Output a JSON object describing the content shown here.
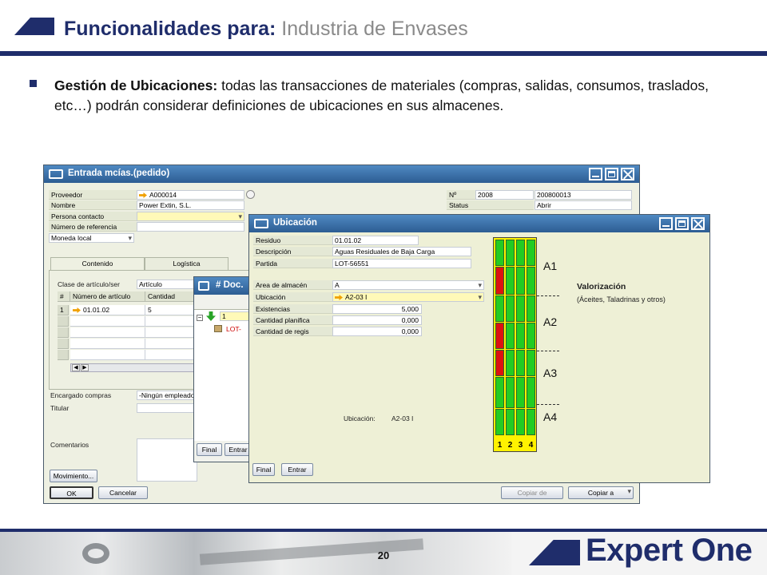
{
  "slide": {
    "title_bold": "Funcionalidades para:",
    "title_rest": " Industria de Envases",
    "bullet_bold": "Gestión de Ubicaciones:",
    "bullet_text": " todas las transacciones de materiales (compras, salidas, consumos, traslados, etc…) podrán considerar definiciones de ubicaciones en sus almacenes.",
    "page_number": "20",
    "logo": "Expert One"
  },
  "win_entrada": {
    "title": "Entrada mcías.(pedido)",
    "labels": [
      "Proveedor",
      "Nombre",
      "Persona contacto",
      "Número de referencia"
    ],
    "proveedor": "A000014",
    "nombre": "Power Extin, S.L.",
    "moneda": "Moneda local",
    "no_label": "Nº",
    "no_value_1": "2008",
    "no_value_2": "200800013",
    "status_label": "Status",
    "status_value": "Abrir",
    "tabs": [
      "Contenido",
      "Logística"
    ],
    "clase_label": "Clase de artículo/ser",
    "clase_value": "Artículo",
    "grid_headers": [
      "#",
      "Número de artículo",
      "Cantidad"
    ],
    "grid_row": [
      "1",
      "01.01.02",
      "5"
    ],
    "encargado_label": "Encargado compras",
    "encargado_value": "-Ningún empleado",
    "titular_label": "Titular",
    "comentarios_label": "Comentarios",
    "mov_button": "Movimiento...",
    "ok_button": "OK",
    "cancel_button": "Cancelar",
    "copiar_de": "Copiar de",
    "copiar_a": "Copiar a"
  },
  "win_doc": {
    "title": "# Doc.",
    "row1": "1",
    "lot": "LOT-",
    "final_button": "Final",
    "entrar_button": "Entrar"
  },
  "win_ubicacion": {
    "title": "Ubicación",
    "residuo_label": "Residuo",
    "residuo": "01.01.02",
    "descripcion_label": "Descripción",
    "descripcion": "Aguas Residuales de Baja Carga",
    "partida_label": "Partida",
    "partida": "LOT-56551",
    "area_label": "Area de almacén",
    "area": "A",
    "ubicacion_label": "Ubicación",
    "ubicacion": "A2-03 I",
    "existencias_label": "Existencias",
    "existencias": "5,000",
    "planificada_label": "Cantidad planifica",
    "planificada": "0,000",
    "registrada_label": "Cantidad de regis",
    "registrada": "0,000",
    "bottom_label": "Ubicación:",
    "bottom_value": "A2-03 I",
    "final_button": "Final",
    "entrar_button": "Entrar",
    "rack_columns": [
      "1",
      "2",
      "3",
      "4"
    ],
    "rack_levels": [
      "A1",
      "A2",
      "A3",
      "A4"
    ],
    "valorizacion_title": "Valorización",
    "valorizacion_sub": "(Áceites, Taladrinas y otros)",
    "colors": {
      "green": "#22cc22",
      "red": "#dd1111",
      "yellow": "#fff200"
    }
  }
}
